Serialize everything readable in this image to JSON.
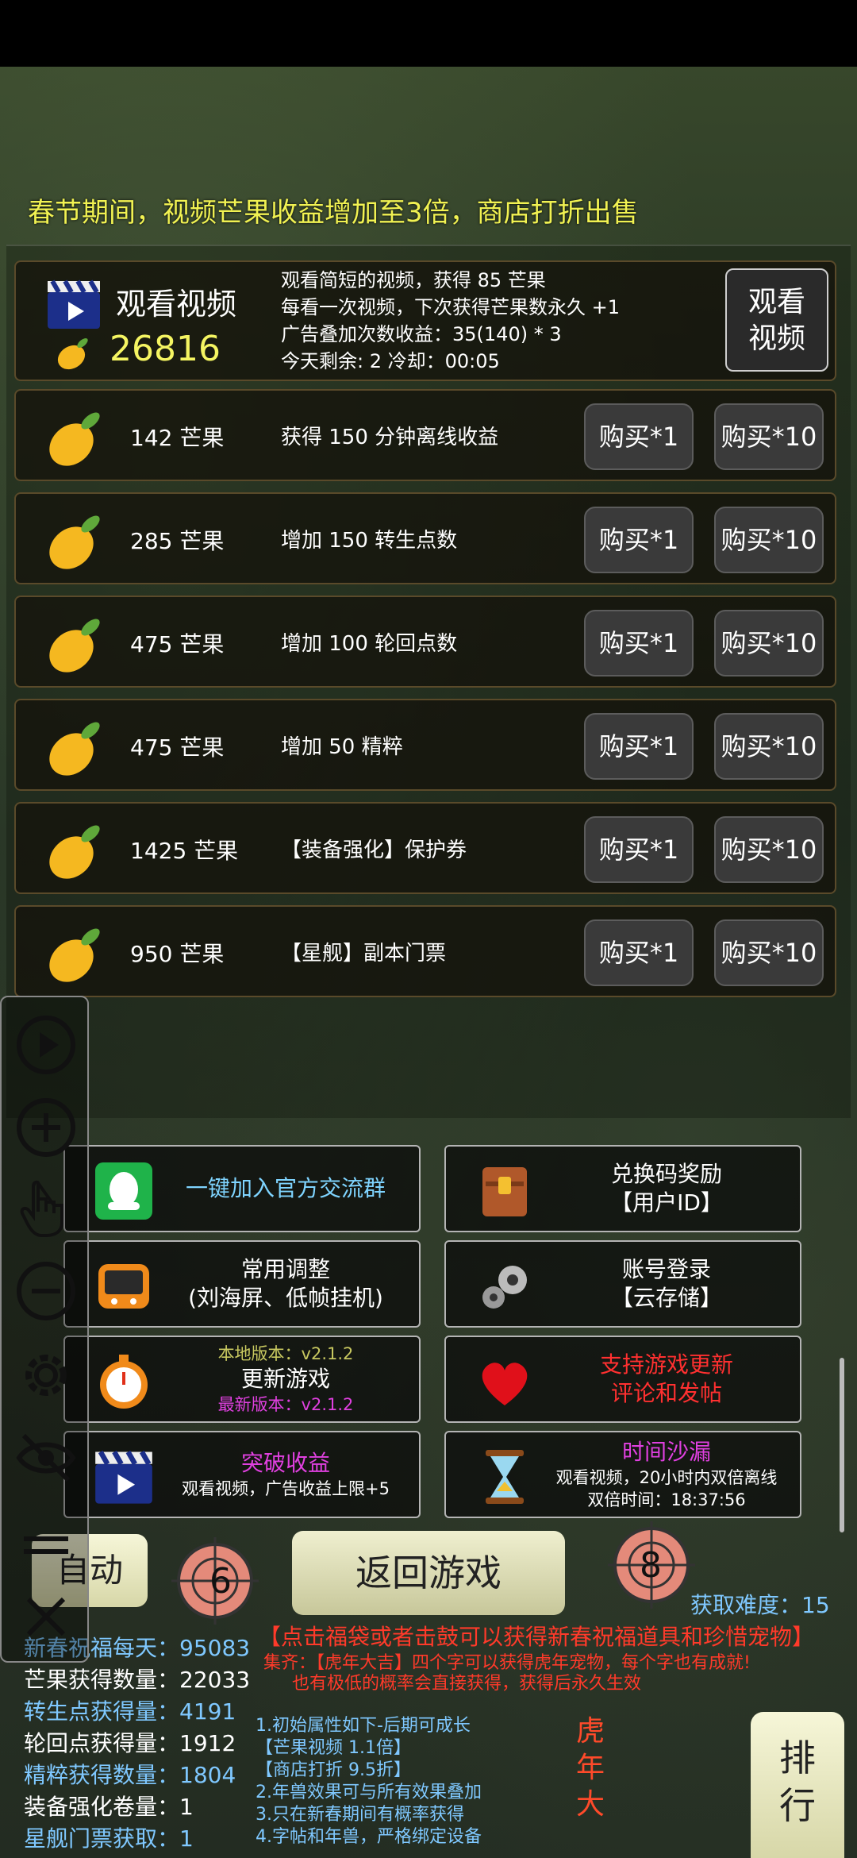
{
  "banner": "春节期间，视频芒果收益增加至3倍，商店打折出售",
  "video": {
    "title": "观看视频",
    "mango_count": "26816",
    "info": [
      "观看简短的视频，获得 85 芒果",
      "每看一次视频，下次获得芒果数永久 +1",
      "广告叠加次数收益：35(140) * 3",
      "今天剩余: 2    冷却：00:05"
    ],
    "button_line1": "观看",
    "button_line2": "视频"
  },
  "shop": {
    "buy1_label": "购买*1",
    "buy10_label": "购买*10",
    "items": [
      {
        "price": "142 芒果",
        "desc": "获得 150 分钟离线收益"
      },
      {
        "price": "285 芒果",
        "desc": "增加 150 转生点数"
      },
      {
        "price": "475 芒果",
        "desc": "增加 100 轮回点数"
      },
      {
        "price": "475 芒果",
        "desc": "增加 50 精粹"
      },
      {
        "price": "1425 芒果",
        "desc": "【装备强化】保护券"
      },
      {
        "price": "950 芒果",
        "desc": "【星舰】副本门票"
      }
    ]
  },
  "menu": {
    "join_group": "一键加入官方交流群",
    "redeem_line1": "兑换码奖励",
    "redeem_line2": "【用户ID】",
    "settings_line1": "常用调整",
    "settings_line2": "(刘海屏、低帧挂机)",
    "login_line1": "账号登录",
    "login_line2": "【云存储】",
    "update_local": "本地版本：v2.1.2",
    "update_label": "更新游戏",
    "update_latest": "最新版本：v2.1.2",
    "support_line1": "支持游戏更新",
    "support_line2": "评论和发帖",
    "breakthrough_title": "突破收益",
    "breakthrough_sub": "观看视频，广告收益上限+5",
    "hourglass_title": "时间沙漏",
    "hourglass_sub": "观看视频，20小时内双倍离线",
    "hourglass_time": "双倍时间：18:37:56"
  },
  "bottom": {
    "auto": "自动",
    "return": "返回游戏",
    "rank_line1": "排",
    "rank_line2": "行",
    "drum_left": "6",
    "drum_right": "8",
    "difficulty": "获取难度：15",
    "promo": "【点击福袋或者击鼓可以获得新春祝福道具和珍惜宠物】",
    "promo2_line1": "集齐：【虎年大吉】四个字可以获得虎年宠物，每个字也有成就!",
    "promo2_line2": "也有极低的概率会直接获得，获得后永久生效",
    "tiger_chars": [
      "虎",
      "年",
      "大"
    ]
  },
  "stats": [
    {
      "text": "新春祝福每天：95083",
      "color": "blue"
    },
    {
      "text": "芒果获得数量：22033",
      "color": "white"
    },
    {
      "text": "转生点获得量：4191",
      "color": "blue"
    },
    {
      "text": "轮回点获得量：1912",
      "color": "white"
    },
    {
      "text": "精粹获得数量：1804",
      "color": "blue"
    },
    {
      "text": "装备强化卷量：1",
      "color": "white"
    },
    {
      "text": "星舰门票获取：1",
      "color": "blue"
    }
  ],
  "rules": [
    "1.初始属性如下-后期可成长",
    "【芒果视频 1.1倍】",
    "【商店打折 9.5折】",
    "2.年兽效果可与所有效果叠加",
    "3.只在新春期间有概率获得",
    "4.字帖和年兽，严格绑定设备"
  ]
}
